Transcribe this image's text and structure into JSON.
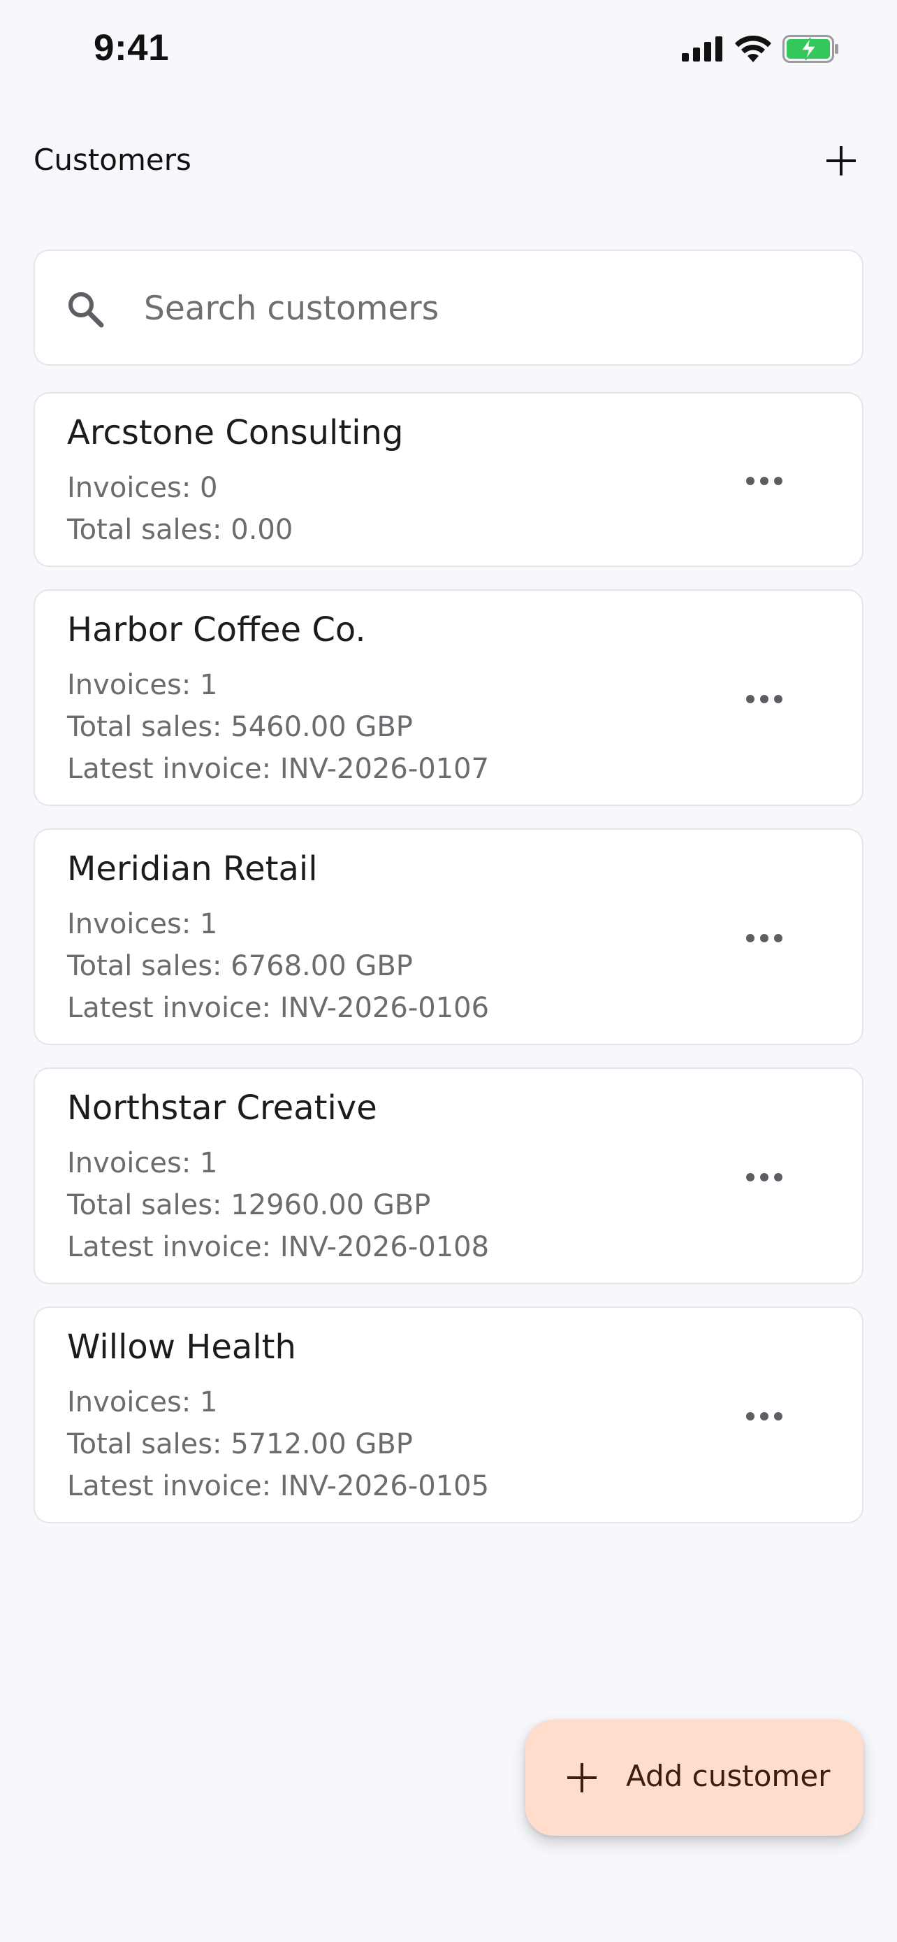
{
  "status_bar": {
    "time": "9:41"
  },
  "header": {
    "title": "Customers"
  },
  "search": {
    "placeholder": "Search customers",
    "value": ""
  },
  "customers": [
    {
      "name": "Arcstone Consulting",
      "invoices": "Invoices: 0",
      "total_sales": "Total sales: 0.00"
    },
    {
      "name": "Harbor Coffee Co.",
      "invoices": "Invoices: 1",
      "total_sales": "Total sales: 5460.00 GBP",
      "latest_invoice": "Latest invoice: INV-2026-0107"
    },
    {
      "name": "Meridian Retail",
      "invoices": "Invoices: 1",
      "total_sales": "Total sales: 6768.00 GBP",
      "latest_invoice": "Latest invoice: INV-2026-0106"
    },
    {
      "name": "Northstar Creative",
      "invoices": "Invoices: 1",
      "total_sales": "Total sales: 12960.00 GBP",
      "latest_invoice": "Latest invoice: INV-2026-0108"
    },
    {
      "name": "Willow Health",
      "invoices": "Invoices: 1",
      "total_sales": "Total sales: 5712.00 GBP",
      "latest_invoice": "Latest invoice: INV-2026-0105"
    }
  ],
  "fab": {
    "label": "Add customer",
    "icon": "plus-icon"
  },
  "icons": {
    "header_add": "plus-icon",
    "search": "search-icon",
    "card_menu": "more-horizontal-icon"
  },
  "colors": {
    "background": "#f7f8fb",
    "card": "#ffffff",
    "card_border": "#e3e5ea",
    "fab_background": "#ffdccc",
    "fab_text": "#3e1d0c",
    "battery_fill": "#34c759"
  }
}
